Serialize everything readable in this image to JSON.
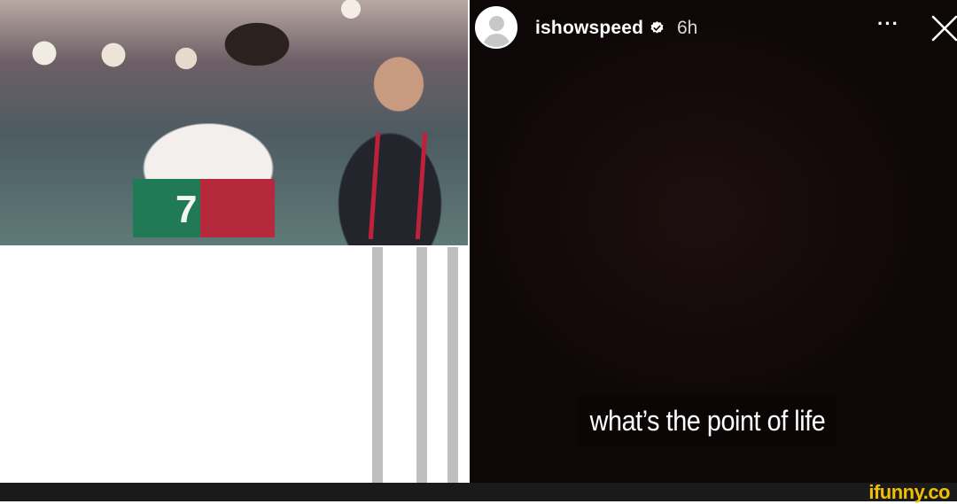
{
  "story": {
    "username": "ishowspeed",
    "time_ago": "6h",
    "more_label": "···",
    "caption": "what’s the point of life"
  },
  "icons": {
    "avatar": "default-avatar-icon",
    "verified": "verified-badge-icon",
    "more": "more-options-icon",
    "close": "close-icon"
  },
  "watermark": "ifunny.co",
  "colors": {
    "story_background": "#120908",
    "verified": "#ffffff",
    "watermark": "#f0c000"
  }
}
